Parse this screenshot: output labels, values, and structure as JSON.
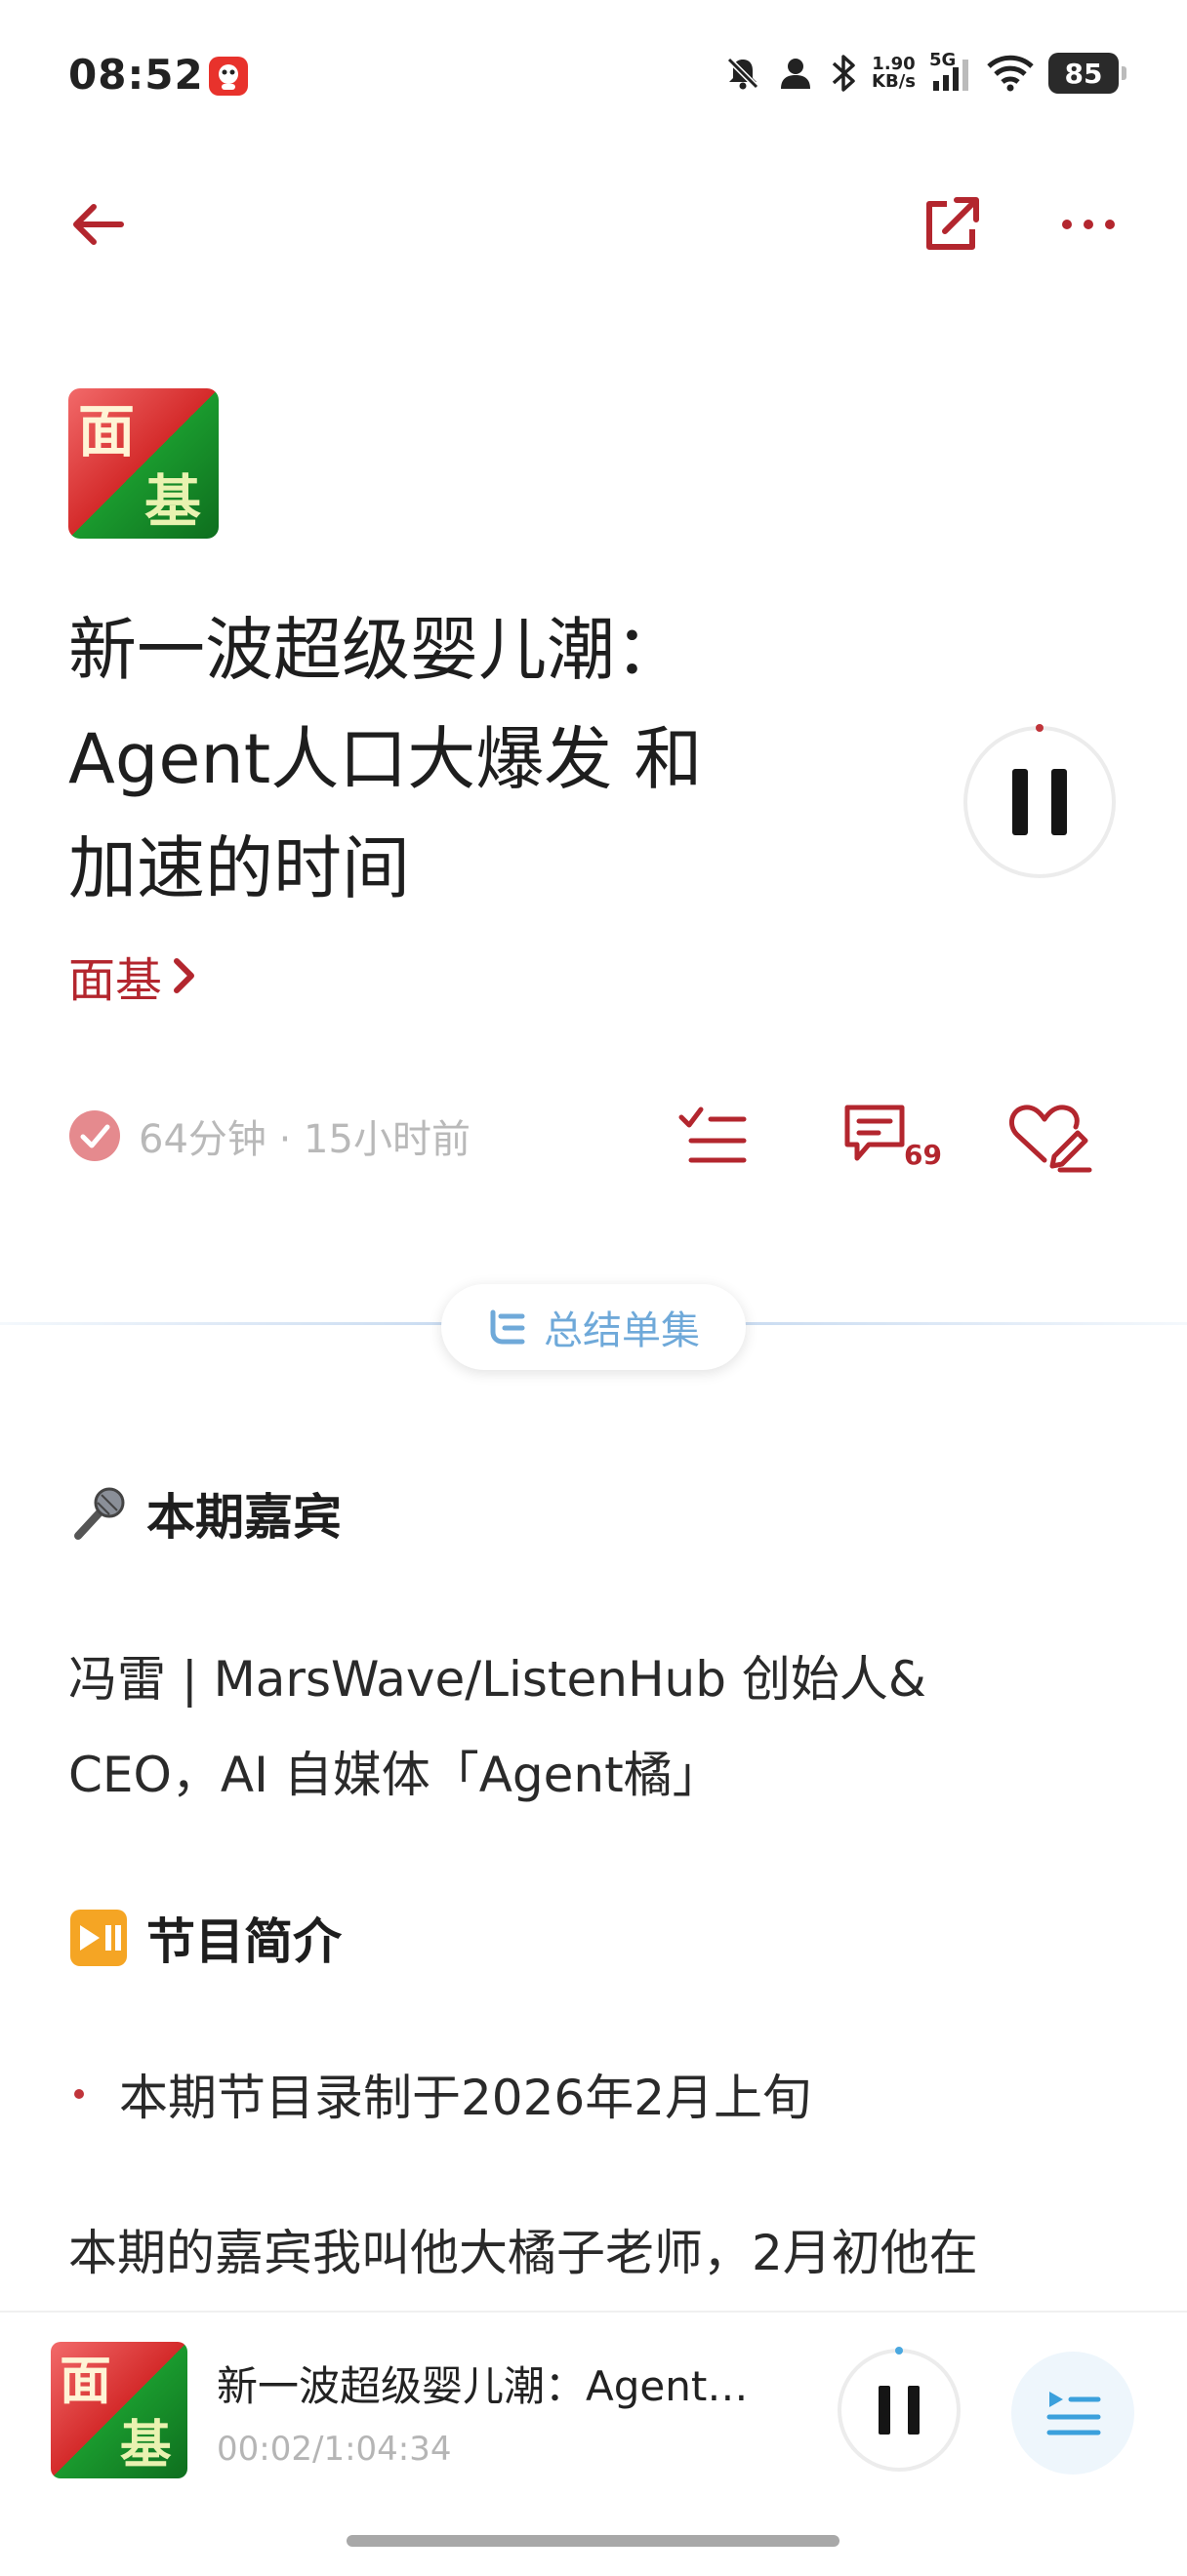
{
  "status_bar": {
    "time": "08:52",
    "net_speed_value": "1.90",
    "net_speed_unit": "KB/s",
    "network_type": "5G",
    "battery": "85",
    "icons": [
      "app-notification-icon",
      "mute-bell-icon",
      "person-icon",
      "bluetooth-icon",
      "signal-icon",
      "wifi-icon",
      "battery-icon"
    ]
  },
  "nav": {
    "icons": [
      "back-arrow-icon",
      "share-icon",
      "more-icon"
    ]
  },
  "cover": {
    "text_top": "面",
    "text_bottom": "基",
    "colors": {
      "red": "#d42a2a",
      "green": "#1a9a2e"
    }
  },
  "episode": {
    "title_line1": "新一波超级婴儿潮：",
    "title_line2": "Agent人口大爆发 和",
    "title_line3": "加速的时间",
    "podcast_name": "面基",
    "duration_and_age": "64分钟 · 15小时前",
    "comment_count": "69",
    "play_state": "playing"
  },
  "summary_button": {
    "label": "总结单集"
  },
  "shownotes": {
    "guest_heading": "本期嘉宾",
    "guest_line1": "冯雷 | MarsWave/ListenHub 创始人&",
    "guest_line2": "CEO，AI 自媒体「Agent橘」",
    "intro_heading": "节目简介",
    "bullet1": "本期节目录制于2026年2月上旬",
    "paragraph_start": "本期的嘉宾我叫他大橘子老师，2月初他在"
  },
  "mini_player": {
    "title": "新一波超级婴儿潮：Agent…",
    "time": "00:02/1:04:34",
    "progress_fraction": 0.0005
  },
  "colors": {
    "accent": "#b3262e",
    "summary_blue": "#6fa9d9",
    "muted": "#b9b9b9"
  }
}
